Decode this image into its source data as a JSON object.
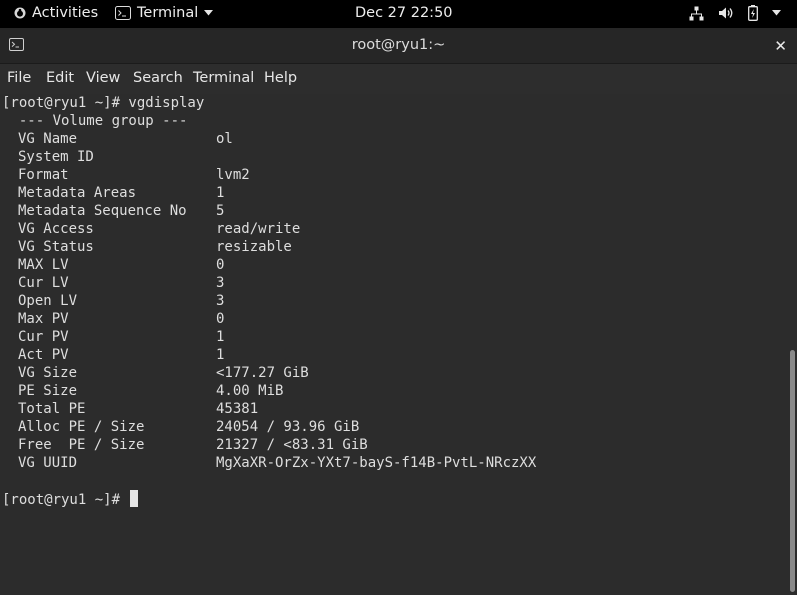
{
  "topbar": {
    "activities": "Activities",
    "app_name": "Terminal",
    "clock": "Dec 27  22:50"
  },
  "window": {
    "title": "root@ryu1:~",
    "close_glyph": "✕"
  },
  "menubar": {
    "items": [
      "File",
      "Edit",
      "View",
      "Search",
      "Terminal",
      "Help"
    ]
  },
  "terminal": {
    "command_line": "[root@ryu1 ~]# vgdisplay",
    "section_header": "  --- Volume group ---",
    "rows": [
      {
        "key": "VG Name",
        "value": "ol"
      },
      {
        "key": "System ID",
        "value": ""
      },
      {
        "key": "Format",
        "value": "lvm2"
      },
      {
        "key": "Metadata Areas",
        "value": "1"
      },
      {
        "key": "Metadata Sequence No",
        "value": "5"
      },
      {
        "key": "VG Access",
        "value": "read/write"
      },
      {
        "key": "VG Status",
        "value": "resizable"
      },
      {
        "key": "MAX LV",
        "value": "0"
      },
      {
        "key": "Cur LV",
        "value": "3"
      },
      {
        "key": "Open LV",
        "value": "3"
      },
      {
        "key": "Max PV",
        "value": "0"
      },
      {
        "key": "Cur PV",
        "value": "1"
      },
      {
        "key": "Act PV",
        "value": "1"
      },
      {
        "key": "VG Size",
        "value": "<177.27 GiB"
      },
      {
        "key": "PE Size",
        "value": "4.00 MiB"
      },
      {
        "key": "Total PE",
        "value": "45381"
      },
      {
        "key": "Alloc PE / Size",
        "value": "24054 / 93.96 GiB"
      },
      {
        "key": "Free  PE / Size",
        "value": "21327 / <83.31 GiB"
      },
      {
        "key": "VG UUID",
        "value": "MgXaXR-OrZx-YXt7-bayS-f14B-PvtL-NRczXX"
      }
    ],
    "prompt": "[root@ryu1 ~]# "
  }
}
